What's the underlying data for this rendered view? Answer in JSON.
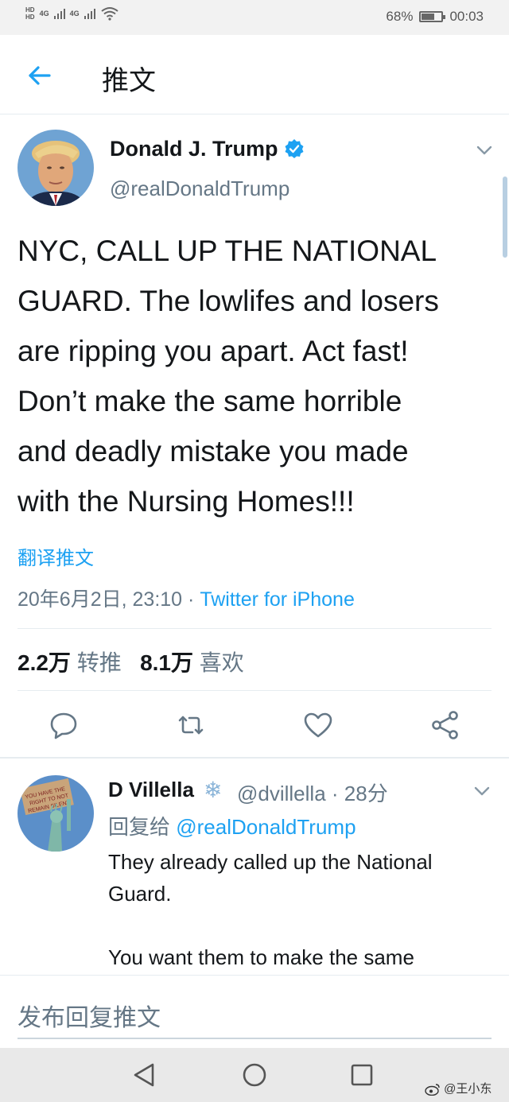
{
  "status_bar": {
    "signal_left": "HD",
    "network_1": "4G",
    "network_2": "4G",
    "battery": "68%",
    "battery_level": 0.68,
    "time": "00:03"
  },
  "header": {
    "title": "推文",
    "back_icon": "arrow-left-icon"
  },
  "tweet": {
    "author_name": "Donald J. Trump",
    "author_handle": "@realDonaldTrump",
    "verified_icon": "verified-badge-icon",
    "text_lines": [
      "NYC, CALL UP THE NATIONAL",
      "GUARD. The lowlifes and losers",
      "are ripping you apart. Act fast!",
      "Don’t make the same horrible",
      "and deadly mistake you made",
      "with the Nursing Homes!!!"
    ],
    "translate_label": "翻译推文",
    "timestamp": "20年6月2日, 23:10",
    "separator": "·",
    "source": "Twitter for iPhone",
    "retweet_count": "2.2万",
    "retweet_label": "转推",
    "like_count": "8.1万",
    "like_label": "喜欢",
    "action_icons": [
      "reply-icon",
      "retweet-icon",
      "like-icon",
      "share-icon"
    ],
    "accent_color": "#1da1f2"
  },
  "reply": {
    "author_name": "D Villella",
    "emoji": "❄",
    "author_handle": "@dvillella",
    "time_separator": "·",
    "time_ago": "28分",
    "reply_to_label": "回复给",
    "reply_to_mention": "@realDonaldTrump",
    "text_line_1": "They already called up the National",
    "text_line_2": "Guard.",
    "text_line_3": "You want them to make the same",
    "avatar_sign_text": "YOU HAVE THE RIGHT TO NOT REMAIN SILENT"
  },
  "compose": {
    "placeholder": "发布回复推文"
  },
  "watermark": "@王小东"
}
